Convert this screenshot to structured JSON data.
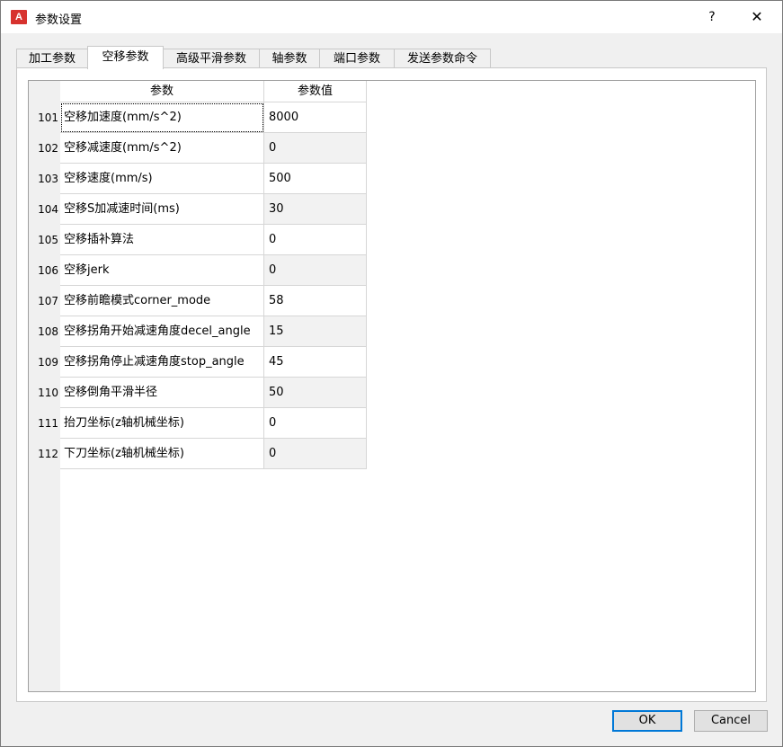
{
  "window": {
    "icon_text": "A",
    "title": "参数设置",
    "help_label": "?",
    "close_label": "✕"
  },
  "tabs": [
    {
      "label": "加工参数",
      "active": false
    },
    {
      "label": "空移参数",
      "active": true
    },
    {
      "label": "高级平滑参数",
      "active": false
    },
    {
      "label": "轴参数",
      "active": false
    },
    {
      "label": "端口参数",
      "active": false
    },
    {
      "label": "发送参数命令",
      "active": false
    }
  ],
  "table": {
    "headers": {
      "name": "参数",
      "value": "参数值"
    },
    "rows": [
      {
        "num": "101",
        "name": "空移加速度(mm/s^2)",
        "value": "8000"
      },
      {
        "num": "102",
        "name": "空移减速度(mm/s^2)",
        "value": "0"
      },
      {
        "num": "103",
        "name": "空移速度(mm/s)",
        "value": "500"
      },
      {
        "num": "104",
        "name": "空移S加减速时间(ms)",
        "value": "30"
      },
      {
        "num": "105",
        "name": "空移插补算法",
        "value": "0"
      },
      {
        "num": "106",
        "name": "空移jerk",
        "value": "0"
      },
      {
        "num": "107",
        "name": "空移前瞻模式corner_mode",
        "value": "58"
      },
      {
        "num": "108",
        "name": "空移拐角开始减速角度decel_angle",
        "value": "15"
      },
      {
        "num": "109",
        "name": "空移拐角停止减速角度stop_angle",
        "value": "45"
      },
      {
        "num": "110",
        "name": "空移倒角平滑半径",
        "value": "50"
      },
      {
        "num": "111",
        "name": "抬刀坐标(z轴机械坐标)",
        "value": "0"
      },
      {
        "num": "112",
        "name": "下刀坐标(z轴机械坐标)",
        "value": "0"
      }
    ]
  },
  "buttons": {
    "ok": "OK",
    "cancel": "Cancel"
  },
  "colors": {
    "value_alt_bg": "#f2f2f2",
    "accent": "#0078d7",
    "icon_bg": "#d7322e"
  }
}
